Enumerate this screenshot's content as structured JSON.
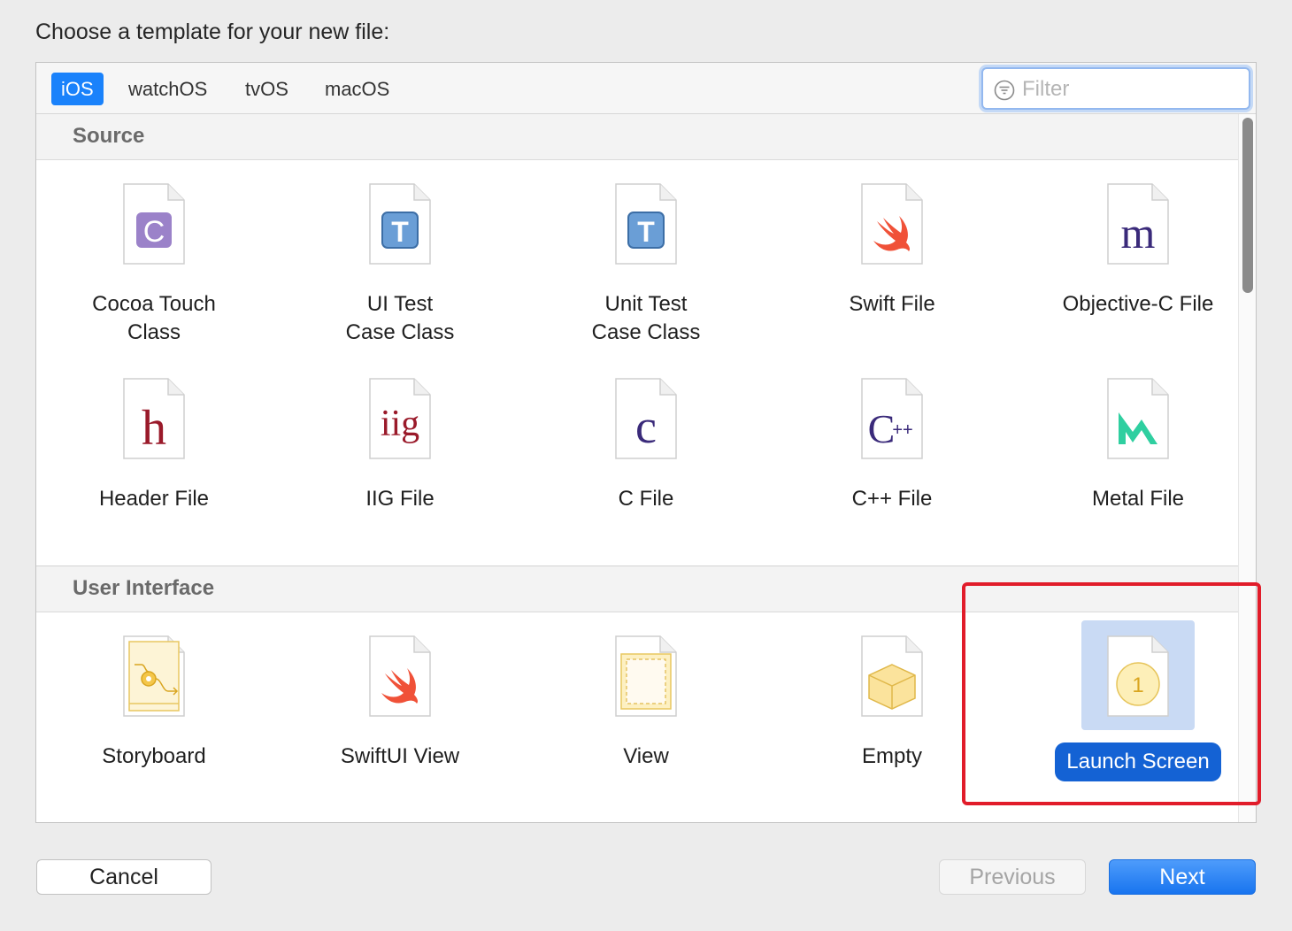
{
  "prompt": "Choose a template for your new file:",
  "platform_tabs": [
    {
      "label": "iOS",
      "selected": true
    },
    {
      "label": "watchOS",
      "selected": false
    },
    {
      "label": "tvOS",
      "selected": false
    },
    {
      "label": "macOS",
      "selected": false
    }
  ],
  "filter": {
    "placeholder": "Filter",
    "value": ""
  },
  "sections": [
    {
      "title": "Source",
      "templates": [
        {
          "label": "Cocoa Touch\nClass",
          "icon": "cocoa-touch-class-icon",
          "glyph": "C"
        },
        {
          "label": "UI Test\nCase Class",
          "icon": "ui-test-case-class-icon",
          "glyph": "T"
        },
        {
          "label": "Unit Test\nCase Class",
          "icon": "unit-test-case-class-icon",
          "glyph": "T"
        },
        {
          "label": "Swift File",
          "icon": "swift-file-icon",
          "glyph": ""
        },
        {
          "label": "Objective-C File",
          "icon": "objective-c-file-icon",
          "glyph": "m"
        },
        {
          "label": "Header File",
          "icon": "header-file-icon",
          "glyph": "h"
        },
        {
          "label": "IIG File",
          "icon": "iig-file-icon",
          "glyph": "iig"
        },
        {
          "label": "C File",
          "icon": "c-file-icon",
          "glyph": "c"
        },
        {
          "label": "C++ File",
          "icon": "cpp-file-icon",
          "glyph": "C++"
        },
        {
          "label": "Metal File",
          "icon": "metal-file-icon",
          "glyph": ""
        }
      ]
    },
    {
      "title": "User Interface",
      "templates": [
        {
          "label": "Storyboard",
          "icon": "storyboard-icon",
          "glyph": ""
        },
        {
          "label": "SwiftUI View",
          "icon": "swiftui-view-icon",
          "glyph": ""
        },
        {
          "label": "View",
          "icon": "view-icon",
          "glyph": ""
        },
        {
          "label": "Empty",
          "icon": "empty-icon",
          "glyph": ""
        },
        {
          "label": "Launch Screen",
          "icon": "launch-screen-icon",
          "glyph": "1",
          "selected": true
        }
      ]
    }
  ],
  "buttons": {
    "cancel": "Cancel",
    "previous": "Previous",
    "next": "Next"
  },
  "colors": {
    "accent": "#1a82fb",
    "selection": "#1462d4",
    "highlight_box": "#e11c2a"
  }
}
